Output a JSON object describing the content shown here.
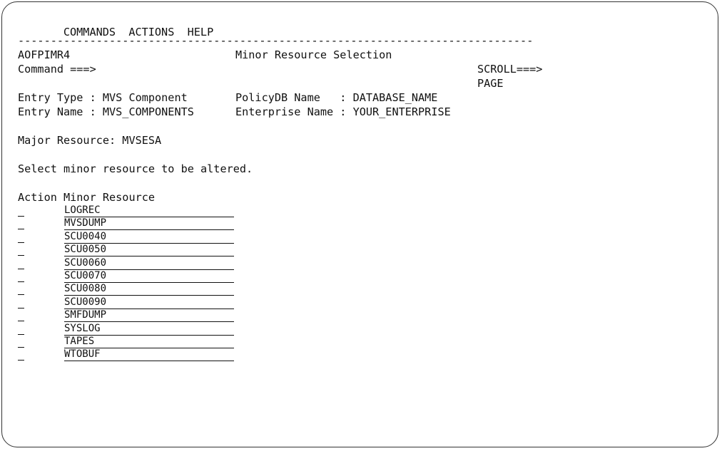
{
  "menu": {
    "items": [
      "COMMANDS",
      "ACTIONS",
      "HELP"
    ]
  },
  "separator": "-------------------------------------------------------------------------------",
  "header": {
    "panel_id": "AOFPIMR4",
    "title": "Minor Resource Selection",
    "command_label": "Command ===>",
    "scroll_label": "SCROLL===> PAGE"
  },
  "entry": {
    "type_line": "Entry Type : MVS Component",
    "name_line": "Entry Name : MVS_COMPONENTS",
    "policydb_line": "PolicyDB Name   : DATABASE_NAME",
    "enterprise_line": "Enterprise Name : YOUR_ENTERPRISE"
  },
  "major_resource_line": "Major Resource: MVSESA",
  "instruction": "Select minor resource to be altered.",
  "list": {
    "header": "Action Minor Resource",
    "items": [
      "LOGREC",
      "MVSDUMP",
      "SCU0040",
      "SCU0050",
      "SCU0060",
      "SCU0070",
      "SCU0080",
      "SCU0090",
      "SMFDUMP",
      "SYSLOG",
      "TAPES",
      "WTOBUF"
    ]
  }
}
